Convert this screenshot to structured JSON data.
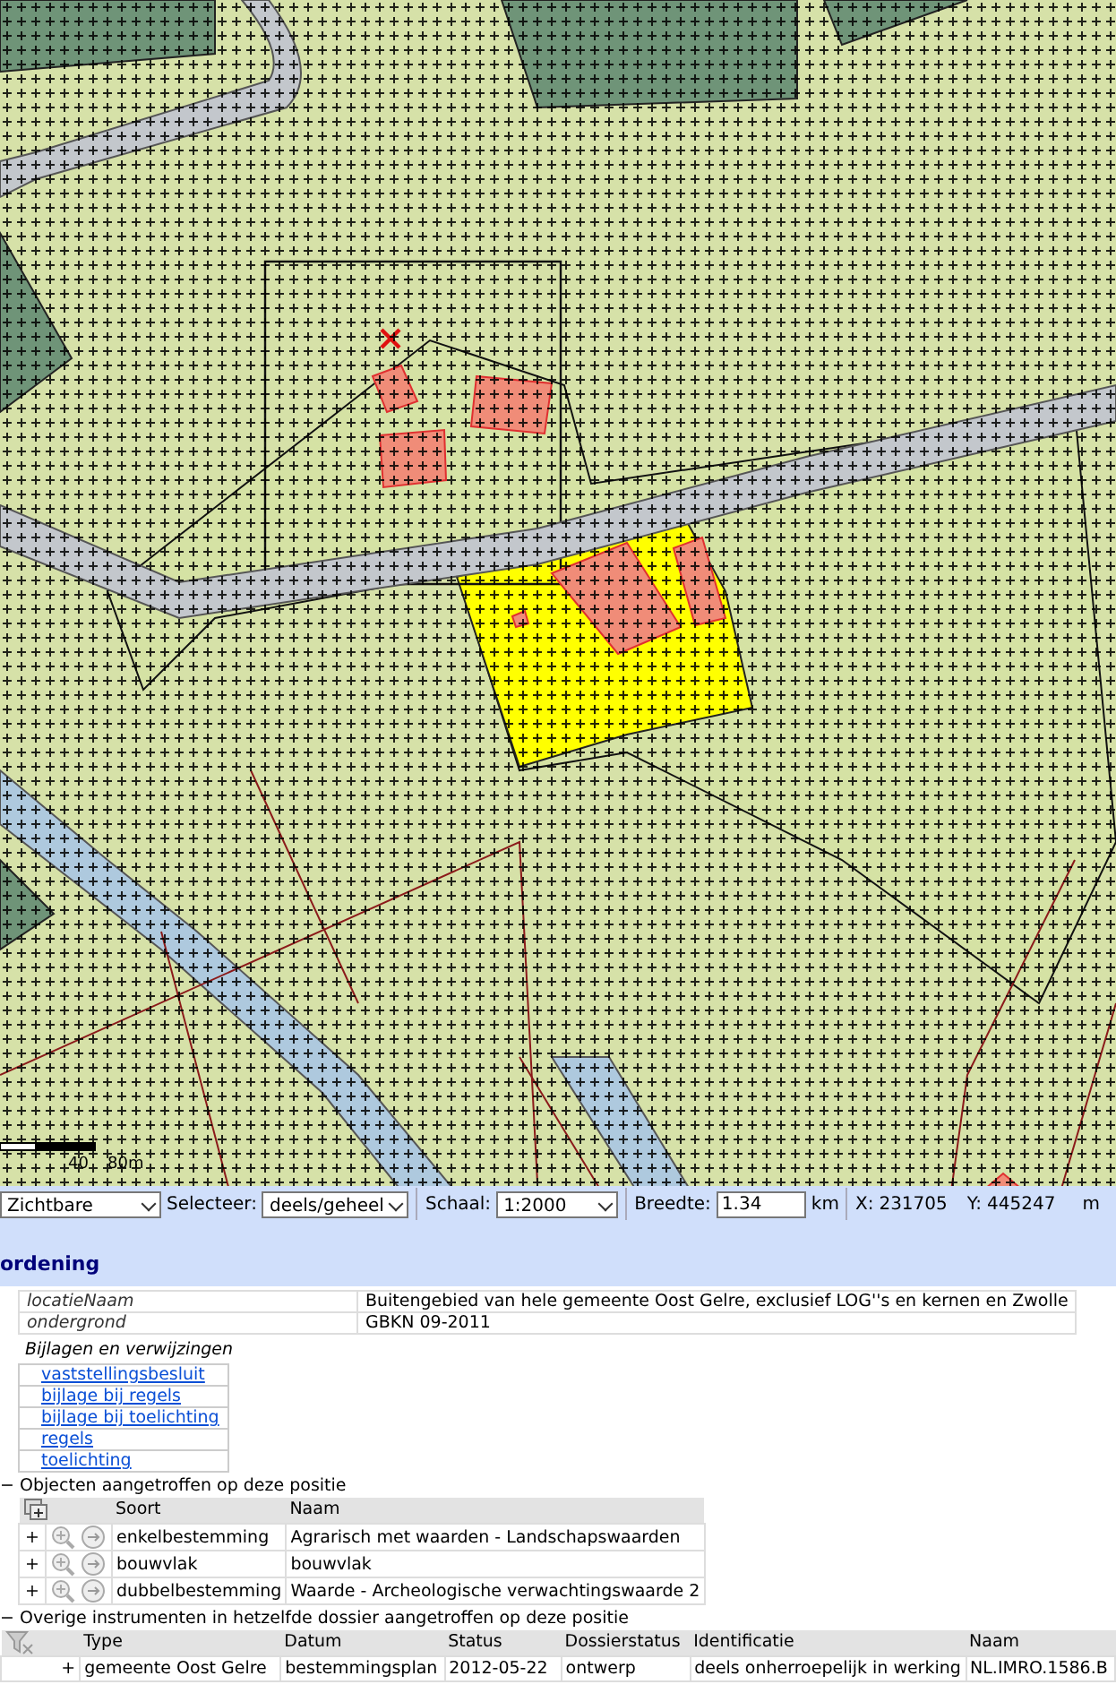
{
  "map": {
    "scale_labels": [
      "40",
      "80m"
    ]
  },
  "toolbar": {
    "layer_select": "Zichtbare",
    "select_label": "Selecteer:",
    "select_value": "deels/geheel",
    "scale_label": "Schaal:",
    "scale_value": "1:2000",
    "width_label": "Breedte:",
    "width_value": "1.34",
    "width_unit": "km",
    "x_label": "X:",
    "x_value": "231705",
    "y_label": "Y:",
    "y_value": "445247",
    "unit": "m"
  },
  "section_title": "ordening",
  "properties": [
    {
      "key": "locatieNaam",
      "value": "Buitengebied van hele gemeente Oost Gelre, exclusief LOG''s en kernen en Zwolle"
    },
    {
      "key": "ondergrond",
      "value": "GBKN 09-2011"
    }
  ],
  "attachments": {
    "title": "Bijlagen en verwijzingen",
    "links": [
      "vaststellingsbesluit",
      "bijlage bij regels",
      "bijlage bij toelichting",
      "regels",
      "toelichting"
    ]
  },
  "objects": {
    "toggle": "−",
    "title": "Objecten aangetroffen op deze positie",
    "columns": [
      "Soort",
      "Naam"
    ],
    "rows": [
      {
        "expander": "+",
        "soort": "enkelbestemming",
        "naam": "Agrarisch met waarden - Landschapswaarden"
      },
      {
        "expander": "+",
        "soort": "bouwvlak",
        "naam": "bouwvlak"
      },
      {
        "expander": "+",
        "soort": "dubbelbestemming",
        "naam": "Waarde - Archeologische verwachtingswaarde 2"
      }
    ]
  },
  "instruments": {
    "toggle": "−",
    "title": "Overige instrumenten in hetzelfde dossier aangetroffen op deze positie",
    "columns": [
      "Type",
      "Datum",
      "Status",
      "Dossierstatus",
      "Identificatie",
      "Naam"
    ],
    "rows": [
      {
        "expander": "+",
        "cells": [
          "gemeente Oost Gelre",
          "bestemmingsplan",
          "2012-05-22",
          "ontwerp",
          "deels onherroepelijk in werking",
          "NL.IMRO.1586.B"
        ]
      }
    ]
  }
}
